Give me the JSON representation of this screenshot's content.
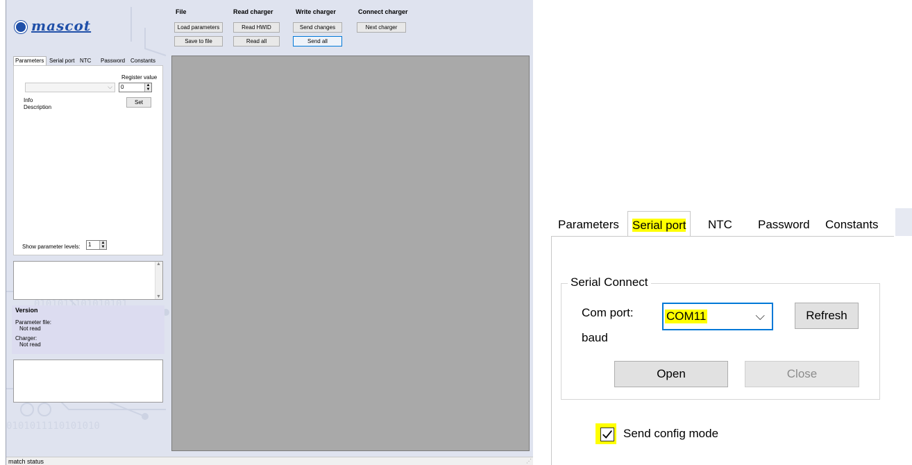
{
  "logo": {
    "text": "mascot",
    "icon": "mascot-badge-icon"
  },
  "toolbar": {
    "file": {
      "header": "File",
      "load": "Load parameters",
      "save": "Save to file"
    },
    "read": {
      "header": "Read charger",
      "hwid": "Read HWID",
      "all": "Read all"
    },
    "write": {
      "header": "Write charger",
      "send_changes": "Send changes",
      "send_all": "Send all"
    },
    "connect": {
      "header": "Connect charger",
      "next": "Next charger"
    }
  },
  "tabs": [
    "Parameters",
    "Serial port",
    "NTC",
    "Password",
    "Constants"
  ],
  "parameters": {
    "register_label": "Register value",
    "register_value": "0",
    "info_label": "Info",
    "description_label": "Description",
    "set_button": "Set",
    "show_levels_label": "Show parameter levels:",
    "show_levels_value": "1"
  },
  "version": {
    "header": "Version",
    "param_file_label": "Parameter file:",
    "param_file_value": "Not read",
    "charger_label": "Charger:",
    "charger_value": "Not read"
  },
  "status": "match status",
  "zoom": {
    "tabs": [
      "Parameters",
      "Serial port",
      "NTC",
      "Password",
      "Constants"
    ],
    "group_title": "Serial Connect",
    "com_port_label": "Com port:",
    "com_port_value": "COM11",
    "baud_label": "baud",
    "refresh": "Refresh",
    "open": "Open",
    "close": "Close",
    "send_config_label": "Send config mode",
    "send_config_checked": true
  },
  "colors": {
    "app_bg": "#dfe3ef",
    "highlight": "#ffff00",
    "accent": "#0078d7",
    "canvas": "#a9a9a9"
  }
}
